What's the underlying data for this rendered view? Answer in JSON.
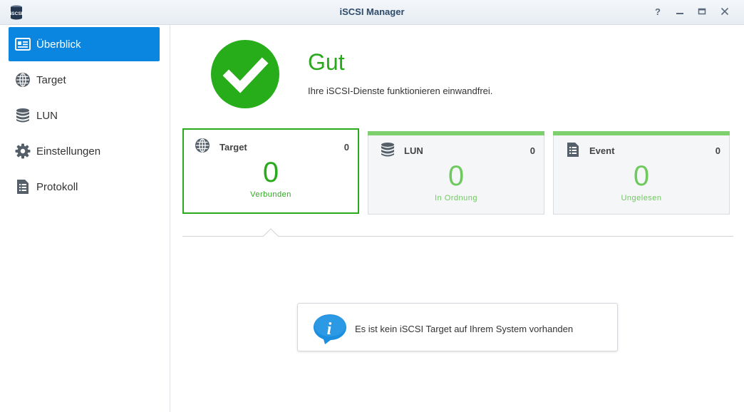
{
  "window": {
    "title": "iSCSI Manager",
    "app_icon_label": "iSCSI"
  },
  "sidebar": {
    "items": [
      {
        "label": "Überblick",
        "icon": "overview-card-icon",
        "active": true
      },
      {
        "label": "Target",
        "icon": "globe-icon"
      },
      {
        "label": "LUN",
        "icon": "database-icon"
      },
      {
        "label": "Einstellungen",
        "icon": "gear-icon"
      },
      {
        "label": "Protokoll",
        "icon": "log-list-icon"
      }
    ]
  },
  "status": {
    "title": "Gut",
    "description": "Ihre iSCSI-Dienste funktionieren einwandfrei.",
    "icon": "checkmark-icon",
    "color": "#27ad1a"
  },
  "cards": [
    {
      "name": "Target",
      "count": "0",
      "big": "0",
      "sub": "Verbunden",
      "icon": "globe-icon"
    },
    {
      "name": "LUN",
      "count": "0",
      "big": "0",
      "sub": "In Ordnung",
      "icon": "database-icon"
    },
    {
      "name": "Event",
      "count": "0",
      "big": "0",
      "sub": "Ungelesen",
      "icon": "document-icon"
    }
  ],
  "info": {
    "message": "Es ist kein iSCSI Target auf Ihrem System vorhanden",
    "icon": "info-icon"
  },
  "colors": {
    "accent": "#0b86e0",
    "good": "#2ba91c"
  }
}
